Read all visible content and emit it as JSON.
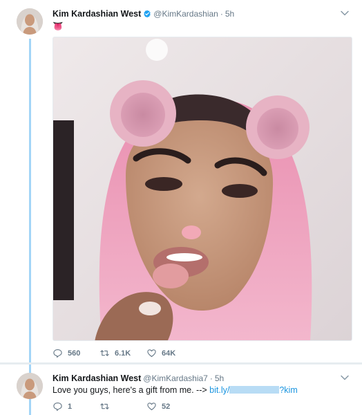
{
  "tweet": {
    "author_name": "Kim Kardashian West",
    "author_handle": "@KimKardashian",
    "separator": "·",
    "time": "5h",
    "text": "👅",
    "actions": {
      "replies": "560",
      "retweets": "6.1K",
      "likes": "64K"
    }
  },
  "reply": {
    "author_name": "Kim Kardashian West",
    "author_handle": "@KimKardashia7",
    "separator": "·",
    "time": "5h",
    "text": "Love you guys, here's a gift from me. -->",
    "link_prefix": "bit.ly/",
    "link_suffix": "?kim",
    "actions": {
      "replies": "1",
      "retweets": "",
      "likes": "52"
    }
  },
  "colors": {
    "thread": "#a3d5f7",
    "link": "#1b95e0",
    "muted": "#657786",
    "verified": "#1da1f2"
  },
  "icons": [
    "verified-badge-icon",
    "chevron-down-icon",
    "reply-icon",
    "retweet-icon",
    "like-icon"
  ]
}
